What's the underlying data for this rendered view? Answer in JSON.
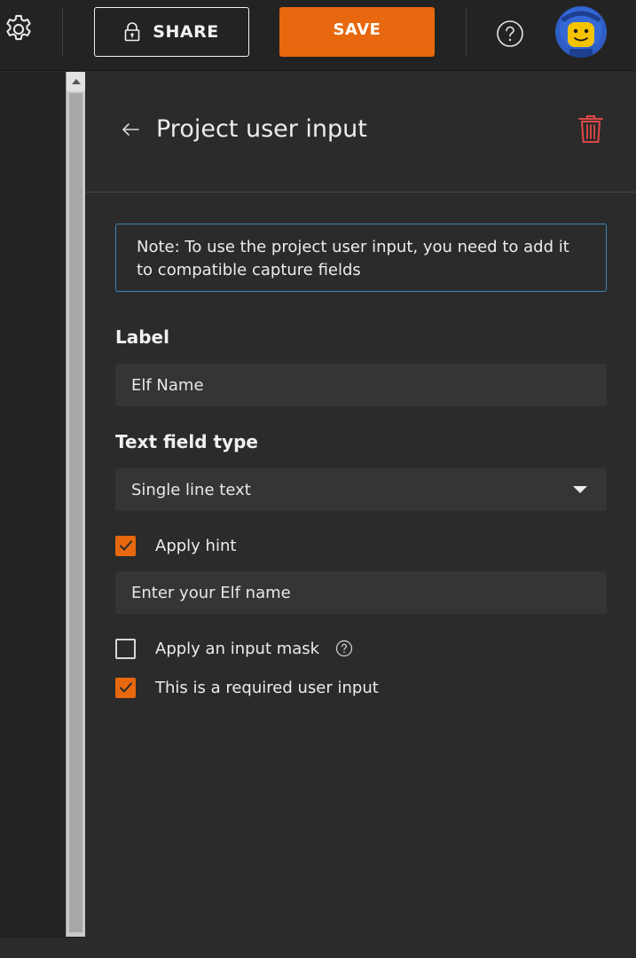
{
  "topbar": {
    "settings_icon": "gear-icon",
    "share_label": "SHARE",
    "share_icon": "lock-icon",
    "save_label": "SAVE",
    "help_icon": "help-circle-icon",
    "avatar_icon": "user-avatar"
  },
  "colors": {
    "accent": "#e7680e",
    "note_border": "#3e86b9",
    "delete": "#e04848",
    "background": "#2b2b2b"
  },
  "panel": {
    "title": "Project user input",
    "back_icon": "arrow-left-icon",
    "delete_icon": "trash-icon",
    "note": "Note: To use the project user input, you need to add it to compatible capture fields",
    "label_heading": "Label",
    "label_value": "Elf Name",
    "text_field_type_heading": "Text field type",
    "text_field_type_value": "Single line text",
    "options": {
      "apply_hint": {
        "label": "Apply hint",
        "checked": true
      },
      "hint_value": "Enter your Elf name",
      "apply_input_mask": {
        "label": "Apply an input mask",
        "checked": false
      },
      "required": {
        "label": "This is a required user input",
        "checked": true
      }
    }
  }
}
